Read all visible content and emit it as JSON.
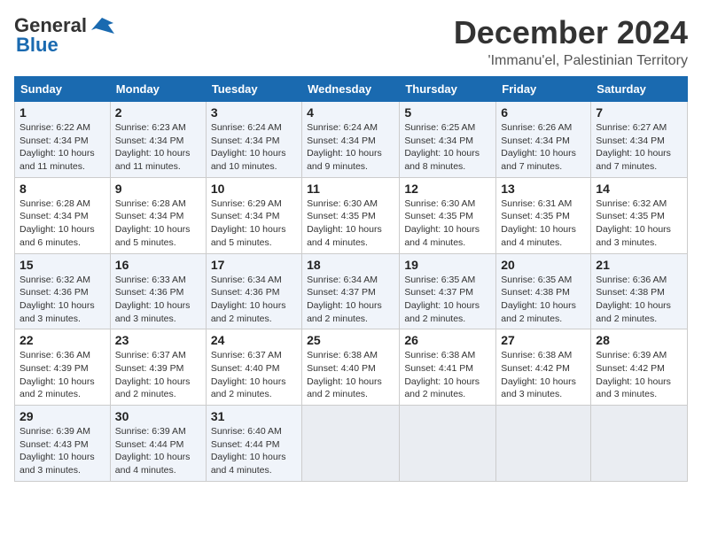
{
  "header": {
    "logo_line1": "General",
    "logo_line2": "Blue",
    "month_title": "December 2024",
    "location": "'Immanu'el, Palestinian Territory"
  },
  "days_of_week": [
    "Sunday",
    "Monday",
    "Tuesday",
    "Wednesday",
    "Thursday",
    "Friday",
    "Saturday"
  ],
  "weeks": [
    [
      {
        "day": "1",
        "sunrise": "6:22 AM",
        "sunset": "4:34 PM",
        "daylight": "10 hours and 11 minutes."
      },
      {
        "day": "2",
        "sunrise": "6:23 AM",
        "sunset": "4:34 PM",
        "daylight": "10 hours and 11 minutes."
      },
      {
        "day": "3",
        "sunrise": "6:24 AM",
        "sunset": "4:34 PM",
        "daylight": "10 hours and 10 minutes."
      },
      {
        "day": "4",
        "sunrise": "6:24 AM",
        "sunset": "4:34 PM",
        "daylight": "10 hours and 9 minutes."
      },
      {
        "day": "5",
        "sunrise": "6:25 AM",
        "sunset": "4:34 PM",
        "daylight": "10 hours and 8 minutes."
      },
      {
        "day": "6",
        "sunrise": "6:26 AM",
        "sunset": "4:34 PM",
        "daylight": "10 hours and 7 minutes."
      },
      {
        "day": "7",
        "sunrise": "6:27 AM",
        "sunset": "4:34 PM",
        "daylight": "10 hours and 7 minutes."
      }
    ],
    [
      {
        "day": "8",
        "sunrise": "6:28 AM",
        "sunset": "4:34 PM",
        "daylight": "10 hours and 6 minutes."
      },
      {
        "day": "9",
        "sunrise": "6:28 AM",
        "sunset": "4:34 PM",
        "daylight": "10 hours and 5 minutes."
      },
      {
        "day": "10",
        "sunrise": "6:29 AM",
        "sunset": "4:34 PM",
        "daylight": "10 hours and 5 minutes."
      },
      {
        "day": "11",
        "sunrise": "6:30 AM",
        "sunset": "4:35 PM",
        "daylight": "10 hours and 4 minutes."
      },
      {
        "day": "12",
        "sunrise": "6:30 AM",
        "sunset": "4:35 PM",
        "daylight": "10 hours and 4 minutes."
      },
      {
        "day": "13",
        "sunrise": "6:31 AM",
        "sunset": "4:35 PM",
        "daylight": "10 hours and 4 minutes."
      },
      {
        "day": "14",
        "sunrise": "6:32 AM",
        "sunset": "4:35 PM",
        "daylight": "10 hours and 3 minutes."
      }
    ],
    [
      {
        "day": "15",
        "sunrise": "6:32 AM",
        "sunset": "4:36 PM",
        "daylight": "10 hours and 3 minutes."
      },
      {
        "day": "16",
        "sunrise": "6:33 AM",
        "sunset": "4:36 PM",
        "daylight": "10 hours and 3 minutes."
      },
      {
        "day": "17",
        "sunrise": "6:34 AM",
        "sunset": "4:36 PM",
        "daylight": "10 hours and 2 minutes."
      },
      {
        "day": "18",
        "sunrise": "6:34 AM",
        "sunset": "4:37 PM",
        "daylight": "10 hours and 2 minutes."
      },
      {
        "day": "19",
        "sunrise": "6:35 AM",
        "sunset": "4:37 PM",
        "daylight": "10 hours and 2 minutes."
      },
      {
        "day": "20",
        "sunrise": "6:35 AM",
        "sunset": "4:38 PM",
        "daylight": "10 hours and 2 minutes."
      },
      {
        "day": "21",
        "sunrise": "6:36 AM",
        "sunset": "4:38 PM",
        "daylight": "10 hours and 2 minutes."
      }
    ],
    [
      {
        "day": "22",
        "sunrise": "6:36 AM",
        "sunset": "4:39 PM",
        "daylight": "10 hours and 2 minutes."
      },
      {
        "day": "23",
        "sunrise": "6:37 AM",
        "sunset": "4:39 PM",
        "daylight": "10 hours and 2 minutes."
      },
      {
        "day": "24",
        "sunrise": "6:37 AM",
        "sunset": "4:40 PM",
        "daylight": "10 hours and 2 minutes."
      },
      {
        "day": "25",
        "sunrise": "6:38 AM",
        "sunset": "4:40 PM",
        "daylight": "10 hours and 2 minutes."
      },
      {
        "day": "26",
        "sunrise": "6:38 AM",
        "sunset": "4:41 PM",
        "daylight": "10 hours and 2 minutes."
      },
      {
        "day": "27",
        "sunrise": "6:38 AM",
        "sunset": "4:42 PM",
        "daylight": "10 hours and 3 minutes."
      },
      {
        "day": "28",
        "sunrise": "6:39 AM",
        "sunset": "4:42 PM",
        "daylight": "10 hours and 3 minutes."
      }
    ],
    [
      {
        "day": "29",
        "sunrise": "6:39 AM",
        "sunset": "4:43 PM",
        "daylight": "10 hours and 3 minutes."
      },
      {
        "day": "30",
        "sunrise": "6:39 AM",
        "sunset": "4:44 PM",
        "daylight": "10 hours and 4 minutes."
      },
      {
        "day": "31",
        "sunrise": "6:40 AM",
        "sunset": "4:44 PM",
        "daylight": "10 hours and 4 minutes."
      },
      null,
      null,
      null,
      null
    ]
  ]
}
